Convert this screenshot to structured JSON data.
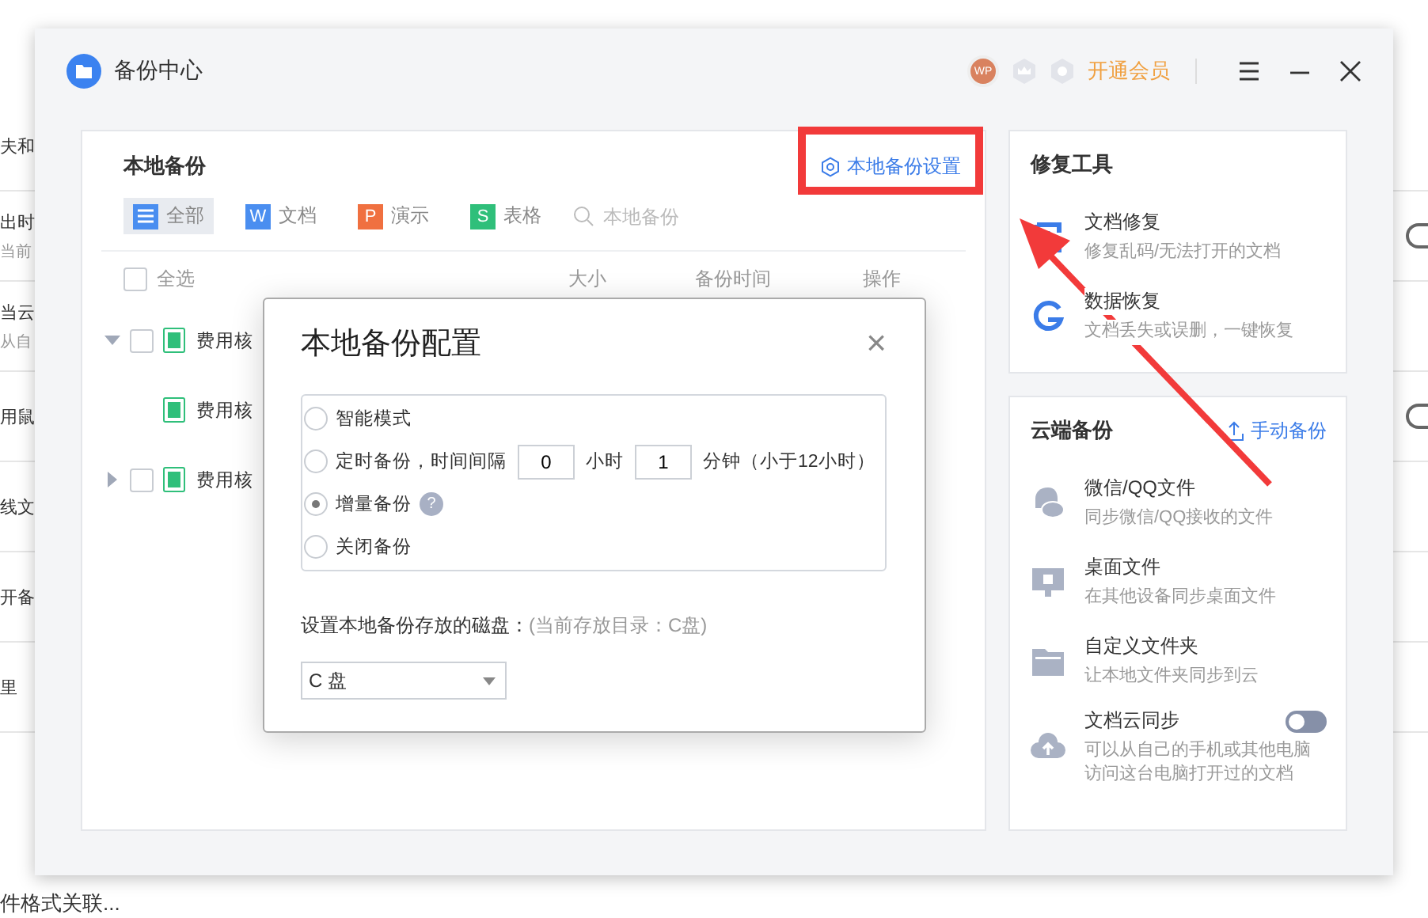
{
  "background_app": {
    "rows": [
      {
        "text": "夫和",
        "switch": false
      },
      {
        "text": "出时",
        "sub": "当前",
        "switch": true
      },
      {
        "text": "当云",
        "sub": "从自",
        "switch": false
      },
      {
        "text": "用鼠",
        "switch": true
      },
      {
        "text": "线文",
        "switch": false
      },
      {
        "text": "开备",
        "switch": false
      },
      {
        "text": "里",
        "switch": false
      }
    ],
    "footer": "件格式关联..."
  },
  "window": {
    "title": "备份中心",
    "avatar": "WP",
    "vip_link": "开通会员"
  },
  "local_backup": {
    "title": "本地备份",
    "settings_link": "本地备份设置",
    "filters": [
      {
        "kind": "all",
        "label": "全部",
        "selected": true
      },
      {
        "kind": "doc",
        "icon_letter": "W",
        "label": "文档",
        "selected": false
      },
      {
        "kind": "ppt",
        "icon_letter": "P",
        "label": "演示",
        "selected": false
      },
      {
        "kind": "sheet",
        "icon_letter": "S",
        "label": "表格",
        "selected": false
      }
    ],
    "search": {
      "placeholder": "本地备份"
    },
    "select_all": {
      "label": "全选",
      "checked": false
    },
    "columns": [
      "大小",
      "备份时间",
      "操作"
    ],
    "rows": [
      {
        "name": "费用核",
        "checked": false,
        "expanded": true,
        "children": [
          {
            "name": "费用核"
          }
        ]
      },
      {
        "name": "费用核",
        "checked": false,
        "expanded": false
      }
    ]
  },
  "dialog": {
    "title": "本地备份配置",
    "close": "×",
    "modes": [
      {
        "kind": "smart",
        "label": "智能模式",
        "selected": false
      },
      {
        "kind": "timed",
        "label": "定时备份，时间间隔",
        "selected": false,
        "hours": "0",
        "hours_unit": "小时",
        "minutes": "1",
        "minutes_unit": "分钟（小于12小时）"
      },
      {
        "kind": "incremental",
        "label": "增量备份",
        "selected": true,
        "help": "?"
      },
      {
        "kind": "off",
        "label": "关闭备份",
        "selected": false
      }
    ],
    "disk_label": "设置本地备份存放的磁盘：",
    "disk_hint": "(当前存放目录：C盘)",
    "disk": {
      "value": "C 盘"
    }
  },
  "repair_tools": {
    "title": "修复工具",
    "items": [
      {
        "kind": "doc_repair",
        "title": "文档修复",
        "desc": "修复乱码/无法打开的文档"
      },
      {
        "kind": "data_recovery",
        "title": "数据恢复",
        "desc": "文档丢失或误删，一键恢复"
      }
    ]
  },
  "cloud_backup": {
    "title": "云端备份",
    "manual_link": "手动备份",
    "items": [
      {
        "kind": "chat",
        "title": "微信/QQ文件",
        "desc": "同步微信/QQ接收的文件"
      },
      {
        "kind": "desktop",
        "title": "桌面文件",
        "desc": "在其他设备同步桌面文件"
      },
      {
        "kind": "folder",
        "title": "自定义文件夹",
        "desc": "让本地文件夹同步到云"
      },
      {
        "kind": "sync",
        "title": "文档云同步",
        "desc": "可以从自己的手机或其他电脑访问这台电脑打开过的文档",
        "toggle": {
          "on": false
        }
      }
    ]
  }
}
